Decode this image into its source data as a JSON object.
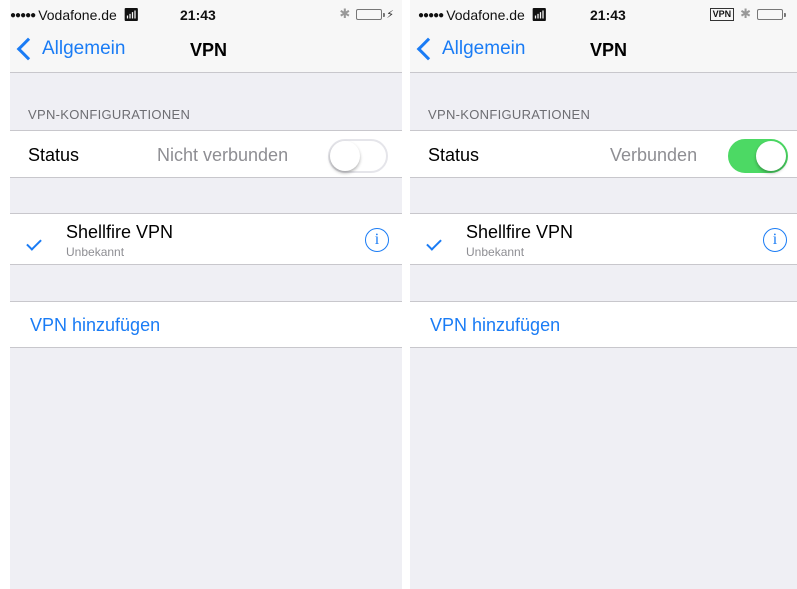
{
  "screens": [
    {
      "status_bar": {
        "signal": "●●●●●",
        "carrier": "Vodafone.de",
        "time": "21:43",
        "vpn_badge": ""
      },
      "nav": {
        "back_label": "Allgemein",
        "title": "VPN"
      },
      "section_header": "VPN-KONFIGURATIONEN",
      "status": {
        "label": "Status",
        "value": "Nicht verbunden",
        "toggle_on": false
      },
      "vpn_item": {
        "name": "Shellfire VPN",
        "subtitle": "Unbekannt",
        "info_glyph": "i"
      },
      "add_label": "VPN hinzufügen"
    },
    {
      "status_bar": {
        "signal": "●●●●●",
        "carrier": "Vodafone.de",
        "time": "21:43",
        "vpn_badge": "VPN"
      },
      "nav": {
        "back_label": "Allgemein",
        "title": "VPN"
      },
      "section_header": "VPN-KONFIGURATIONEN",
      "status": {
        "label": "Status",
        "value": "Verbunden",
        "toggle_on": true
      },
      "vpn_item": {
        "name": "Shellfire VPN",
        "subtitle": "Unbekannt",
        "info_glyph": "i"
      },
      "add_label": "VPN hinzufügen"
    }
  ],
  "colors": {
    "accent": "#1a7cf5",
    "toggle_on": "#4cd964",
    "background": "#efeff4"
  }
}
